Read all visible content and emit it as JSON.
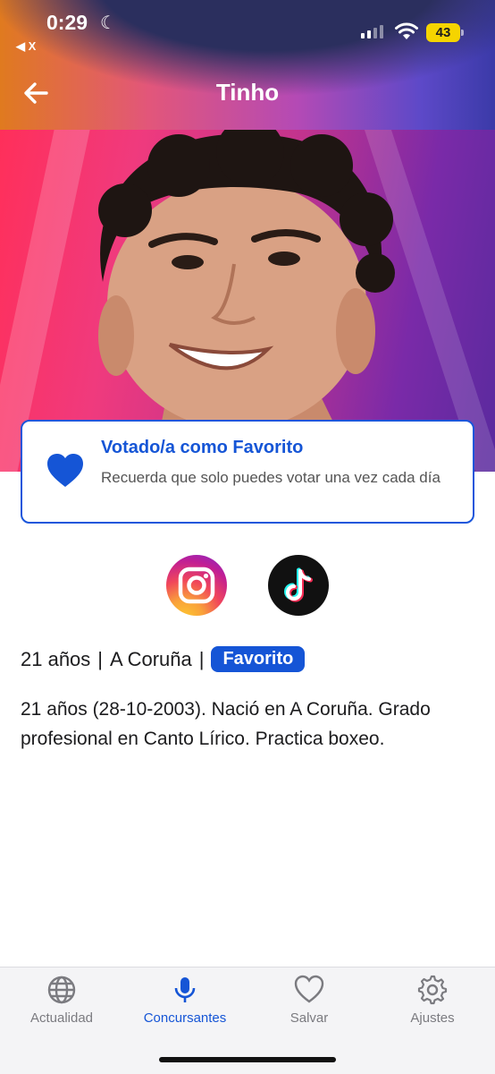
{
  "status_bar": {
    "time": "0:29",
    "back_app": "◀ X",
    "battery": "43"
  },
  "header": {
    "title": "Tinho"
  },
  "vote_card": {
    "title": "Votado/a como Favorito",
    "subtitle": "Recuerda que solo puedes votar una vez cada día"
  },
  "social": {
    "icons": [
      "instagram-icon",
      "tiktok-icon"
    ]
  },
  "meta": {
    "age": "21 años",
    "separator1": "|",
    "city": "A Coruña",
    "separator2": "|",
    "badge": "Favorito"
  },
  "bio": "21 años (28-10-2003).  Nació en A Coruña. Grado profesional en Canto Lírico. Practica boxeo.",
  "tabbar": {
    "items": [
      {
        "label": "Actualidad",
        "icon": "globe-icon",
        "active": false
      },
      {
        "label": "Concursantes",
        "icon": "microphone-icon",
        "active": true
      },
      {
        "label": "Salvar",
        "icon": "heart-icon",
        "active": false
      },
      {
        "label": "Ajustes",
        "icon": "gear-icon",
        "active": false
      }
    ]
  },
  "colors": {
    "accent": "#1555d6",
    "badge_bg": "#1555d6",
    "inactive_tab": "#7b7b80"
  }
}
